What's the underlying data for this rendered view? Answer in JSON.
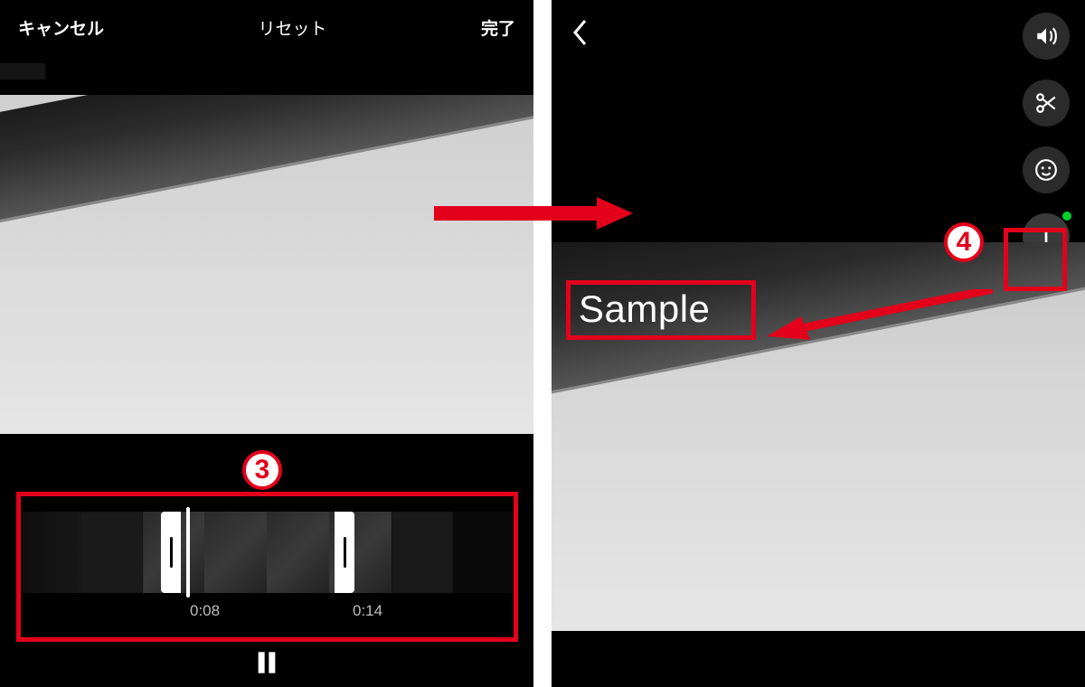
{
  "left": {
    "topbar": {
      "cancel": "キャンセル",
      "reset": "リセット",
      "done": "完了"
    },
    "trim": {
      "start": "0:08",
      "end": "0:14"
    }
  },
  "right": {
    "overlay_text": "Sample"
  },
  "annotations": {
    "step3": "3",
    "step4": "4"
  }
}
